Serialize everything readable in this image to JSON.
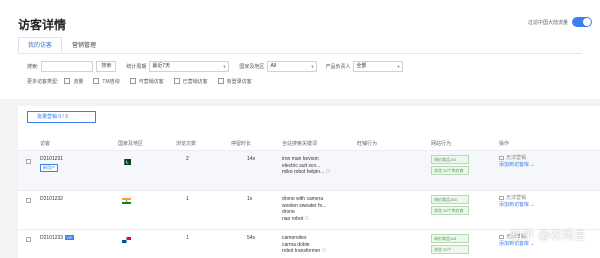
{
  "header": {
    "title": "访客详情",
    "toggle_label": "过滤中国大陆流量",
    "toggle_on": true
  },
  "tabs": [
    {
      "label": "我的访客",
      "active": true
    },
    {
      "label": "营销管理",
      "active": false
    }
  ],
  "filters": {
    "search_label": "搜索:",
    "search_value": "",
    "search_button": "搜索",
    "period_label": "统计周期",
    "period_value": "最近7天",
    "region_label": "国家及地区",
    "region_value": "All",
    "owner_label": "产品负责人",
    "owner_value": "全部"
  },
  "visitor_types": {
    "label": "更多访客类型:",
    "options": [
      "流量",
      "TM咨询",
      "可营销访客",
      "已营销访客",
      "有登录访客"
    ]
  },
  "bulk_button": "批量营销  0 / 5",
  "table": {
    "headers": [
      "访客",
      "国家及地区",
      "浏览次数",
      "停留时长",
      "全站搜索关键词",
      "旺铺行为",
      "网站行为",
      "操作"
    ],
    "rows": [
      {
        "id": "D2101231",
        "tag": "新用户",
        "vip": "",
        "flag": "pakistan-flag",
        "views": "2",
        "duration": "14s",
        "keywords": [
          "iron man kevson",
          "electric suit sco...",
          "miko robot helpin..."
        ],
        "site_tags": [
          "询价商品141",
          "浏览 32个供应商"
        ],
        "ops": [
          "无法营销",
          "添加到访客库"
        ]
      },
      {
        "id": "D2101232",
        "tag": "",
        "vip": "",
        "flag": "india-flag",
        "views": "1",
        "duration": "1s",
        "keywords": [
          "drone with camera",
          "woolen sweater fo...",
          "drone",
          "nao robot"
        ],
        "site_tags": [
          "询价商品153",
          "浏览 30个供应商"
        ],
        "ops": [
          "无法营销",
          "添加到访客库"
        ]
      },
      {
        "id": "D2101233",
        "tag": "",
        "vip": "VIP",
        "flag": "panama-flag",
        "views": "1",
        "duration": "54s",
        "keywords": [
          "cameroites",
          "carma doble",
          "robot transformer"
        ],
        "site_tags": [
          "询价商品118",
          "浏览 32个"
        ],
        "ops": [
          "无法营销",
          "添加到访客库"
        ]
      }
    ]
  },
  "watermark": "知乎 @农场主",
  "colors": {
    "accent": "#3d7ff0",
    "tag_green": "#4a9a4a",
    "page_bg": "#f2f3f5"
  }
}
